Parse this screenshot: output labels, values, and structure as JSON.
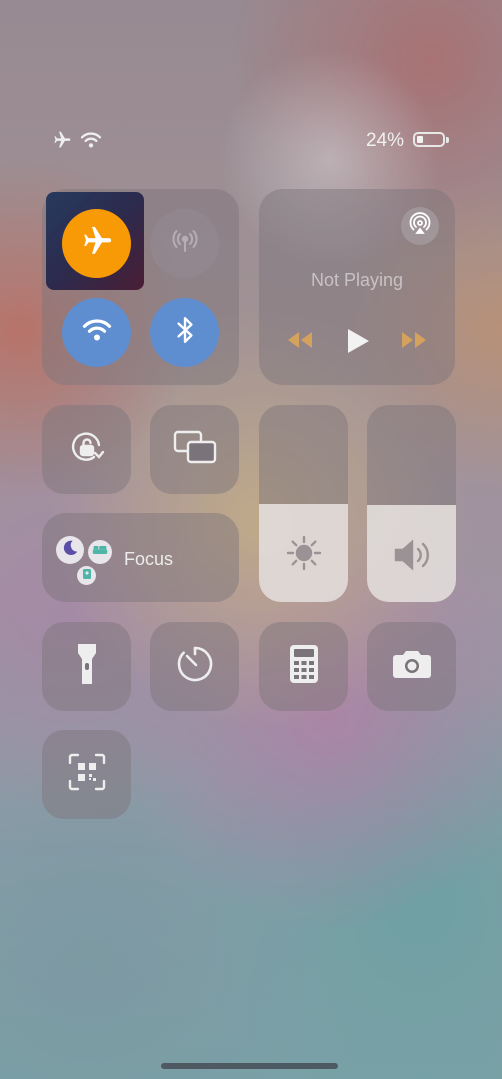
{
  "status_bar": {
    "airplane_icon": "airplane-icon",
    "wifi_icon": "wifi-icon",
    "battery_percent": "24%",
    "battery_level": 0.24
  },
  "connectivity": {
    "airplane_mode": {
      "icon": "airplane-icon",
      "state": "on",
      "color": "#f79a06"
    },
    "cellular_data": {
      "icon": "cellular-antenna-icon",
      "state": "off"
    },
    "wifi": {
      "icon": "wifi-icon",
      "state": "on",
      "color": "#5e8ed0"
    },
    "bluetooth": {
      "icon": "bluetooth-icon",
      "state": "on",
      "color": "#5e8ed0"
    }
  },
  "media": {
    "title": "Not Playing",
    "airplay_icon": "airplay-audio-icon",
    "rewind_icon": "rewind-icon",
    "play_icon": "play-icon",
    "forward_icon": "fast-forward-icon"
  },
  "controls": {
    "orientation_lock_icon": "rotation-lock-icon",
    "screen_mirroring_icon": "screen-mirroring-icon",
    "focus": {
      "label": "Focus",
      "icons": [
        "moon-icon",
        "bed-icon",
        "person-badge-icon"
      ]
    },
    "brightness": {
      "icon": "sun-icon",
      "level": 0.5
    },
    "volume": {
      "icon": "speaker-icon",
      "level": 0.49
    },
    "flashlight_icon": "flashlight-icon",
    "timer_icon": "timer-icon",
    "calculator_icon": "calculator-icon",
    "camera_icon": "camera-icon",
    "code_scanner_icon": "qr-code-scanner-icon"
  },
  "colors": {
    "accent_orange": "#f79a06",
    "accent_blue": "#5e8ed0",
    "media_control_dim": "#d4a25c"
  }
}
